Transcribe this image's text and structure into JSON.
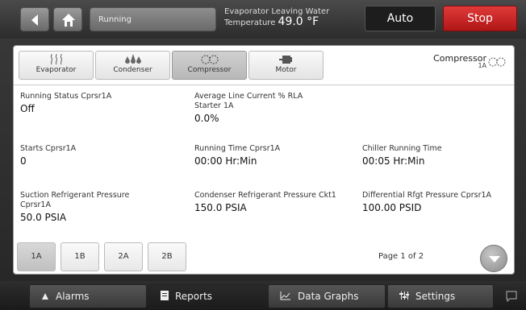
{
  "header": {
    "status": "Running",
    "evap_label": "Evaporator Leaving Water",
    "temp_prefix": "Temperature",
    "temp_value": "49.0 °F",
    "auto_label": "Auto",
    "stop_label": "Stop"
  },
  "tabs": [
    {
      "label": "Evaporator",
      "icon": "steam-icon"
    },
    {
      "label": "Condenser",
      "icon": "droplets-icon"
    },
    {
      "label": "Compressor",
      "icon": "compressor-icon"
    },
    {
      "label": "Motor",
      "icon": "motor-icon"
    }
  ],
  "component": {
    "title": "Compressor",
    "sub": "1A"
  },
  "fields": [
    {
      "label": "Running Status Cprsr1A",
      "value": "Off"
    },
    {
      "label": "Average Line Current % RLA Starter 1A",
      "value": "0.0%"
    },
    {
      "label": "Starts Cprsr1A",
      "value": "0"
    },
    {
      "label": "Running Time Cprsr1A",
      "value": "00:00 Hr:Min"
    },
    {
      "label": "Chiller Running Time",
      "value": "00:05 Hr:Min"
    },
    {
      "label": "Suction Refrigerant Pressure Cprsr1A",
      "value": "50.0 PSIA"
    },
    {
      "label": "Condenser Refrigerant Pressure Ckt1",
      "value": "150.0 PSIA"
    },
    {
      "label": "Differential Rfgt Pressure Cprsr1A",
      "value": "100.00 PSID"
    }
  ],
  "page_tabs": [
    "1A",
    "1B",
    "2A",
    "2B"
  ],
  "page_indicator": "Page 1 of 2",
  "nav": {
    "alarms": "Alarms",
    "reports": "Reports",
    "graphs": "Data Graphs",
    "settings": "Settings"
  }
}
